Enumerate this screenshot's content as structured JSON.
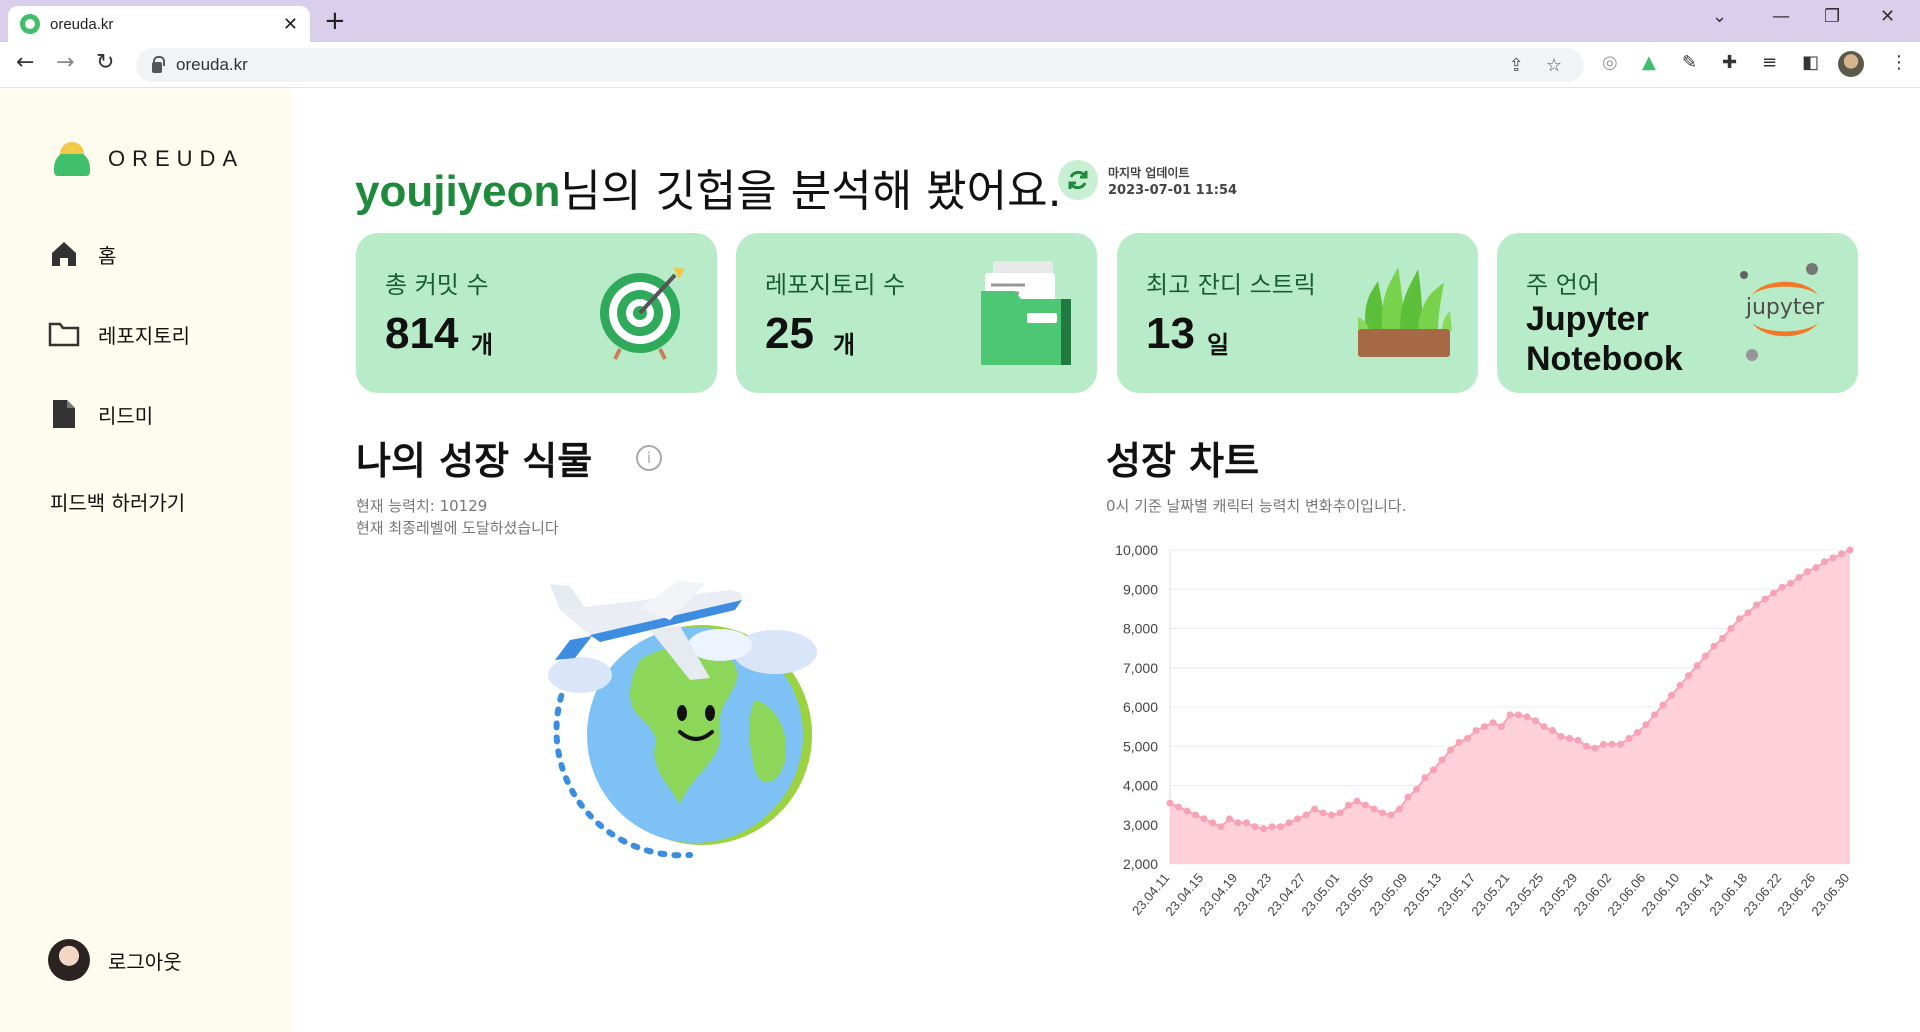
{
  "browser": {
    "tab_title": "oreuda.kr",
    "url": "oreuda.kr"
  },
  "sidebar": {
    "logo": "OREUDA",
    "items": [
      {
        "label": "홈",
        "icon": "home-icon"
      },
      {
        "label": "레포지토리",
        "icon": "folder-icon"
      },
      {
        "label": "리드미",
        "icon": "file-icon"
      }
    ],
    "feedback": "피드백 하러가기",
    "logout": "로그아웃"
  },
  "header": {
    "username": "youjiyeon",
    "title_suffix": "님의 깃헙을 분석해 봤어요.",
    "update_label": "마지막 업데이트",
    "update_time": "2023-07-01 11:54"
  },
  "cards": [
    {
      "caption": "총 커밋 수",
      "value": "814",
      "unit": "개",
      "icon": "target-icon"
    },
    {
      "caption": "레포지토리 수",
      "value": "25",
      "unit": "개",
      "icon": "folder-green-icon"
    },
    {
      "caption": "최고 잔디 스트릭",
      "value": "13",
      "unit": "일",
      "icon": "grass-icon"
    },
    {
      "caption": "주 언어",
      "value": "Jupyter Notebook",
      "icon": "jupyter-logo-icon",
      "logo_text": "jupyter"
    }
  ],
  "plant": {
    "title": "나의 성장 식물",
    "ability": "현재 능력치: 10129",
    "level_msg": "현재 최종레벨에 도달하셨습니다"
  },
  "growth": {
    "title": "성장 차트",
    "subtitle": "0시 기준 날짜별 캐릭터 능력치 변화추이입니다."
  },
  "chart_data": {
    "type": "area",
    "title": "",
    "xlabel": "",
    "ylabel": "",
    "ylim": [
      2000,
      10000
    ],
    "yticks": [
      "10,000",
      "9,000",
      "8,000",
      "7,000",
      "6,000",
      "5,000",
      "4,000",
      "3,000",
      "2,000"
    ],
    "categories": [
      "23.04.11",
      "23.04.12",
      "23.04.13",
      "23.04.14",
      "23.04.15",
      "23.04.16",
      "23.04.17",
      "23.04.18",
      "23.04.19",
      "23.04.20",
      "23.04.21",
      "23.04.22",
      "23.04.23",
      "23.04.24",
      "23.04.25",
      "23.04.26",
      "23.04.27",
      "23.04.28",
      "23.04.29",
      "23.04.30",
      "23.05.01",
      "23.05.02",
      "23.05.03",
      "23.05.04",
      "23.05.05",
      "23.05.06",
      "23.05.07",
      "23.05.08",
      "23.05.09",
      "23.05.10",
      "23.05.11",
      "23.05.12",
      "23.05.13",
      "23.05.14",
      "23.05.15",
      "23.05.16",
      "23.05.17",
      "23.05.18",
      "23.05.19",
      "23.05.20",
      "23.05.21",
      "23.05.22",
      "23.05.23",
      "23.05.24",
      "23.05.25",
      "23.05.26",
      "23.05.27",
      "23.05.28",
      "23.05.29",
      "23.05.30",
      "23.05.31",
      "23.06.01",
      "23.06.02",
      "23.06.03",
      "23.06.04",
      "23.06.05",
      "23.06.06",
      "23.06.07",
      "23.06.08",
      "23.06.09",
      "23.06.10",
      "23.06.11",
      "23.06.12",
      "23.06.13",
      "23.06.14",
      "23.06.15",
      "23.06.16",
      "23.06.17",
      "23.06.18",
      "23.06.19",
      "23.06.20",
      "23.06.21",
      "23.06.22",
      "23.06.23",
      "23.06.24",
      "23.06.25",
      "23.06.26",
      "23.06.27",
      "23.06.28",
      "23.06.29",
      "23.06.30"
    ],
    "xticks_shown": [
      "23.04.11",
      "23.04.15",
      "23.04.19",
      "23.04.23",
      "23.04.27",
      "23.05.01",
      "23.05.05",
      "23.05.09",
      "23.05.13",
      "23.05.17",
      "23.05.21",
      "23.05.25",
      "23.05.29",
      "23.06.02",
      "23.06.06",
      "23.06.10",
      "23.06.14",
      "23.06.18",
      "23.06.22",
      "23.06.26",
      "23.06.30"
    ],
    "values": [
      3550,
      3450,
      3350,
      3250,
      3150,
      3050,
      2950,
      3150,
      3050,
      3050,
      2950,
      2900,
      2950,
      2950,
      3050,
      3150,
      3250,
      3400,
      3300,
      3250,
      3300,
      3500,
      3600,
      3500,
      3400,
      3300,
      3250,
      3400,
      3700,
      3900,
      4200,
      4400,
      4650,
      4900,
      5100,
      5200,
      5400,
      5500,
      5600,
      5500,
      5800,
      5800,
      5750,
      5650,
      5500,
      5400,
      5250,
      5200,
      5150,
      5000,
      4950,
      5050,
      5050,
      5050,
      5200,
      5350,
      5550,
      5800,
      6050,
      6300,
      6550,
      6800,
      7050,
      7300,
      7550,
      7750,
      8000,
      8250,
      8400,
      8600,
      8750,
      8900,
      9050,
      9150,
      9300,
      9450,
      9550,
      9700,
      9800,
      9900,
      10000
    ],
    "color": "#f7a3b5",
    "fill": "#fdd0da",
    "grid": true,
    "legend": "none"
  }
}
